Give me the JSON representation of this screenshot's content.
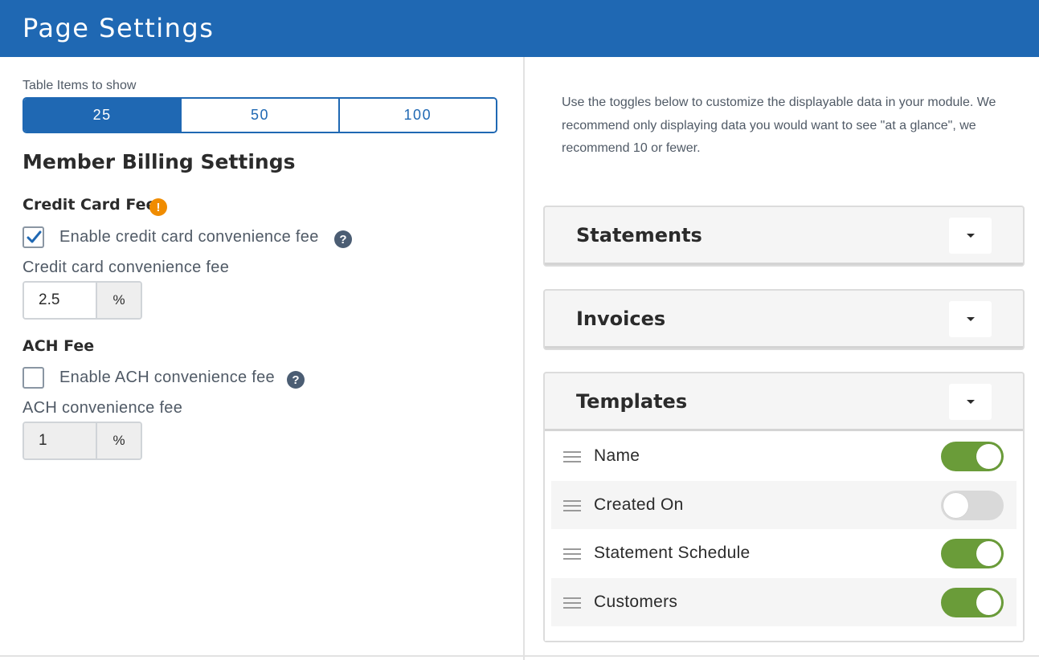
{
  "header": {
    "title": "Page Settings"
  },
  "table_items": {
    "label": "Table Items to show",
    "options": [
      "25",
      "50",
      "100"
    ],
    "selected": "25"
  },
  "billing": {
    "title": "Member Billing Settings",
    "credit_card": {
      "heading": "Credit Card Fee",
      "warning_icon": "!",
      "checkbox_label": "Enable credit card convenience fee",
      "checked": true,
      "help_icon": "?",
      "field_label": "Credit card convenience fee",
      "value": "2.5",
      "unit": "%"
    },
    "ach": {
      "heading": "ACH Fee",
      "checkbox_label": "Enable ACH convenience fee",
      "checked": false,
      "help_icon": "?",
      "field_label": "ACH convenience fee",
      "value": "1",
      "unit": "%"
    }
  },
  "intro_text": "Use the toggles below to customize the displayable data in your module. We recommend only displaying data you would want to see \"at a glance\", we recommend 10 or fewer.",
  "panels": [
    {
      "title": "Statements"
    },
    {
      "title": "Invoices"
    },
    {
      "title": "Templates",
      "rows": [
        {
          "label": "Name",
          "on": true
        },
        {
          "label": "Created On",
          "on": false
        },
        {
          "label": "Statement Schedule",
          "on": true
        },
        {
          "label": "Customers",
          "on": true
        }
      ]
    }
  ],
  "colors": {
    "primary": "#1f68b3",
    "toggle_on": "#6a9c39",
    "toggle_off": "#d9d9d9",
    "warning": "#f08c00",
    "help": "#4b5d73"
  }
}
